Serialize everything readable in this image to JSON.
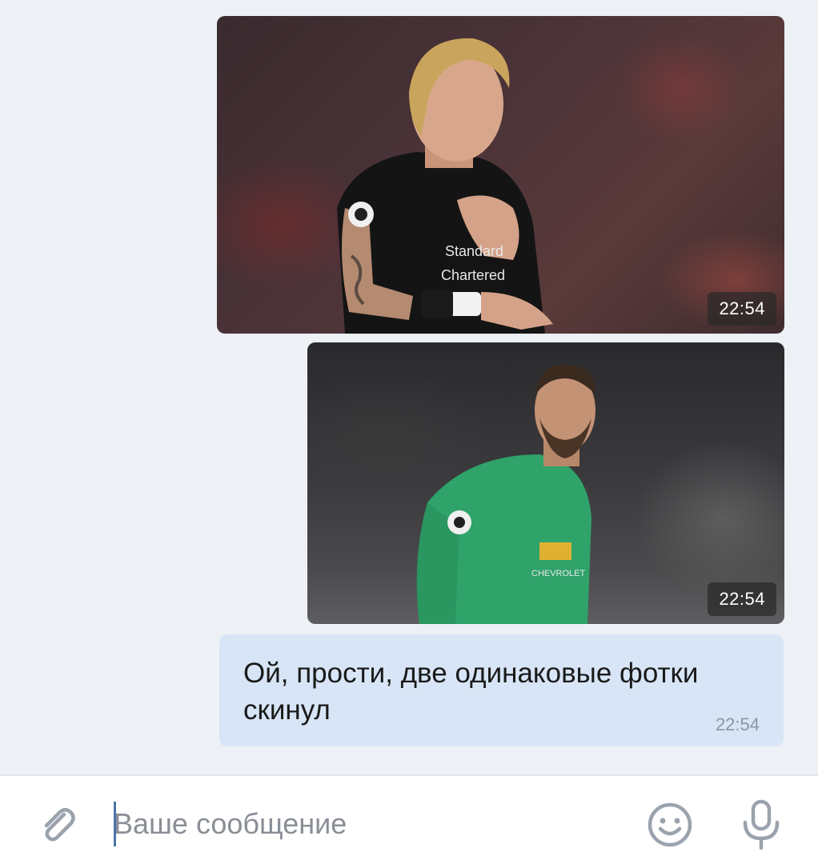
{
  "messages": [
    {
      "type": "photo",
      "description": "goalkeeper-black-kit",
      "time": "22:54"
    },
    {
      "type": "photo",
      "description": "goalkeeper-green-kit",
      "time": "22:54"
    },
    {
      "type": "text",
      "text": "Ой, прости, две одинаковые фотки скинул",
      "time": "22:54"
    }
  ],
  "composer": {
    "placeholder": "Ваше сообщение",
    "value": ""
  },
  "icons": {
    "attach": "paperclip-icon",
    "emoji": "smiley-icon",
    "mic": "microphone-icon"
  },
  "colors": {
    "chat_background": "#edf0f5",
    "outgoing_bubble": "#d7e5f6",
    "accent": "#4a76a8",
    "icon": "#9aa3ad"
  }
}
